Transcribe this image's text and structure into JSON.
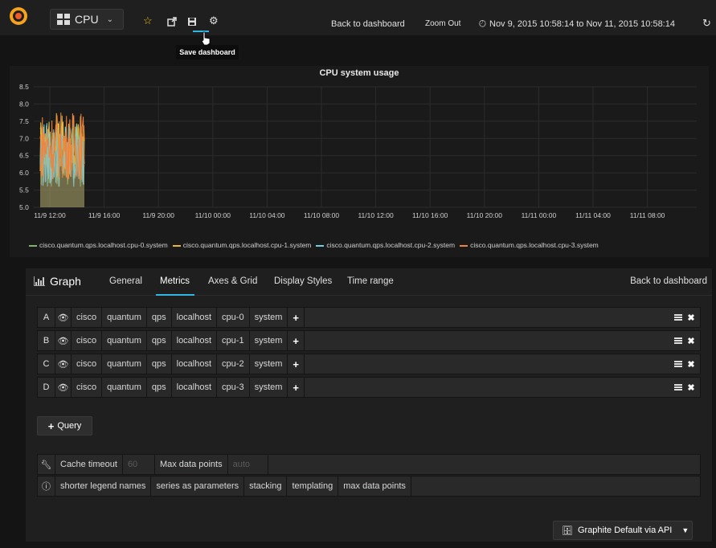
{
  "topbar": {
    "dashboard_title": "CPU",
    "back_to_dashboard": "Back to dashboard",
    "zoom_out": "Zoom Out",
    "time_range": "Nov 9, 2015 10:58:14 to Nov 11, 2015 10:58:14",
    "tooltip": "Save dashboard"
  },
  "chart_data": {
    "type": "line",
    "title": "CPU system usage",
    "y_ticks": [
      "8.5",
      "8.0",
      "7.5",
      "7.0",
      "6.5",
      "6.0",
      "5.5",
      "5.0"
    ],
    "x_ticks": [
      "11/9 12:00",
      "11/9 16:00",
      "11/9 20:00",
      "11/10 00:00",
      "11/10 04:00",
      "11/10 08:00",
      "11/10 12:00",
      "11/10 16:00",
      "11/10 20:00",
      "11/11 00:00",
      "11/11 04:00",
      "11/11 08:00"
    ],
    "ylim": [
      5.0,
      8.5
    ],
    "series": [
      {
        "name": "cisco.quantum.qps.localhost.cpu-0.system",
        "color": "#7eb26d"
      },
      {
        "name": "cisco.quantum.qps.localhost.cpu-1.system",
        "color": "#eab839"
      },
      {
        "name": "cisco.quantum.qps.localhost.cpu-2.system",
        "color": "#6ed0e0"
      },
      {
        "name": "cisco.quantum.qps.localhost.cpu-3.system",
        "color": "#ef843c"
      }
    ]
  },
  "editor": {
    "panel_type": "Graph",
    "tabs": [
      "General",
      "Metrics",
      "Axes & Grid",
      "Display Styles",
      "Time range"
    ],
    "back_to_dashboard": "Back to dashboard",
    "queries": [
      {
        "ref": "A",
        "segments": [
          "cisco",
          "quantum",
          "qps",
          "localhost",
          "cpu-0",
          "system"
        ]
      },
      {
        "ref": "B",
        "segments": [
          "cisco",
          "quantum",
          "qps",
          "localhost",
          "cpu-1",
          "system"
        ]
      },
      {
        "ref": "C",
        "segments": [
          "cisco",
          "quantum",
          "qps",
          "localhost",
          "cpu-2",
          "system"
        ]
      },
      {
        "ref": "D",
        "segments": [
          "cisco",
          "quantum",
          "qps",
          "localhost",
          "cpu-3",
          "system"
        ]
      }
    ],
    "add_query": "Query",
    "cache_timeout_label": "Cache timeout",
    "cache_timeout_value": "60",
    "max_data_points_label": "Max data points",
    "max_data_points_value": "auto",
    "help_items": [
      "shorter legend names",
      "series as parameters",
      "stacking",
      "templating",
      "max data points"
    ],
    "datasource": "Graphite Default via API"
  }
}
